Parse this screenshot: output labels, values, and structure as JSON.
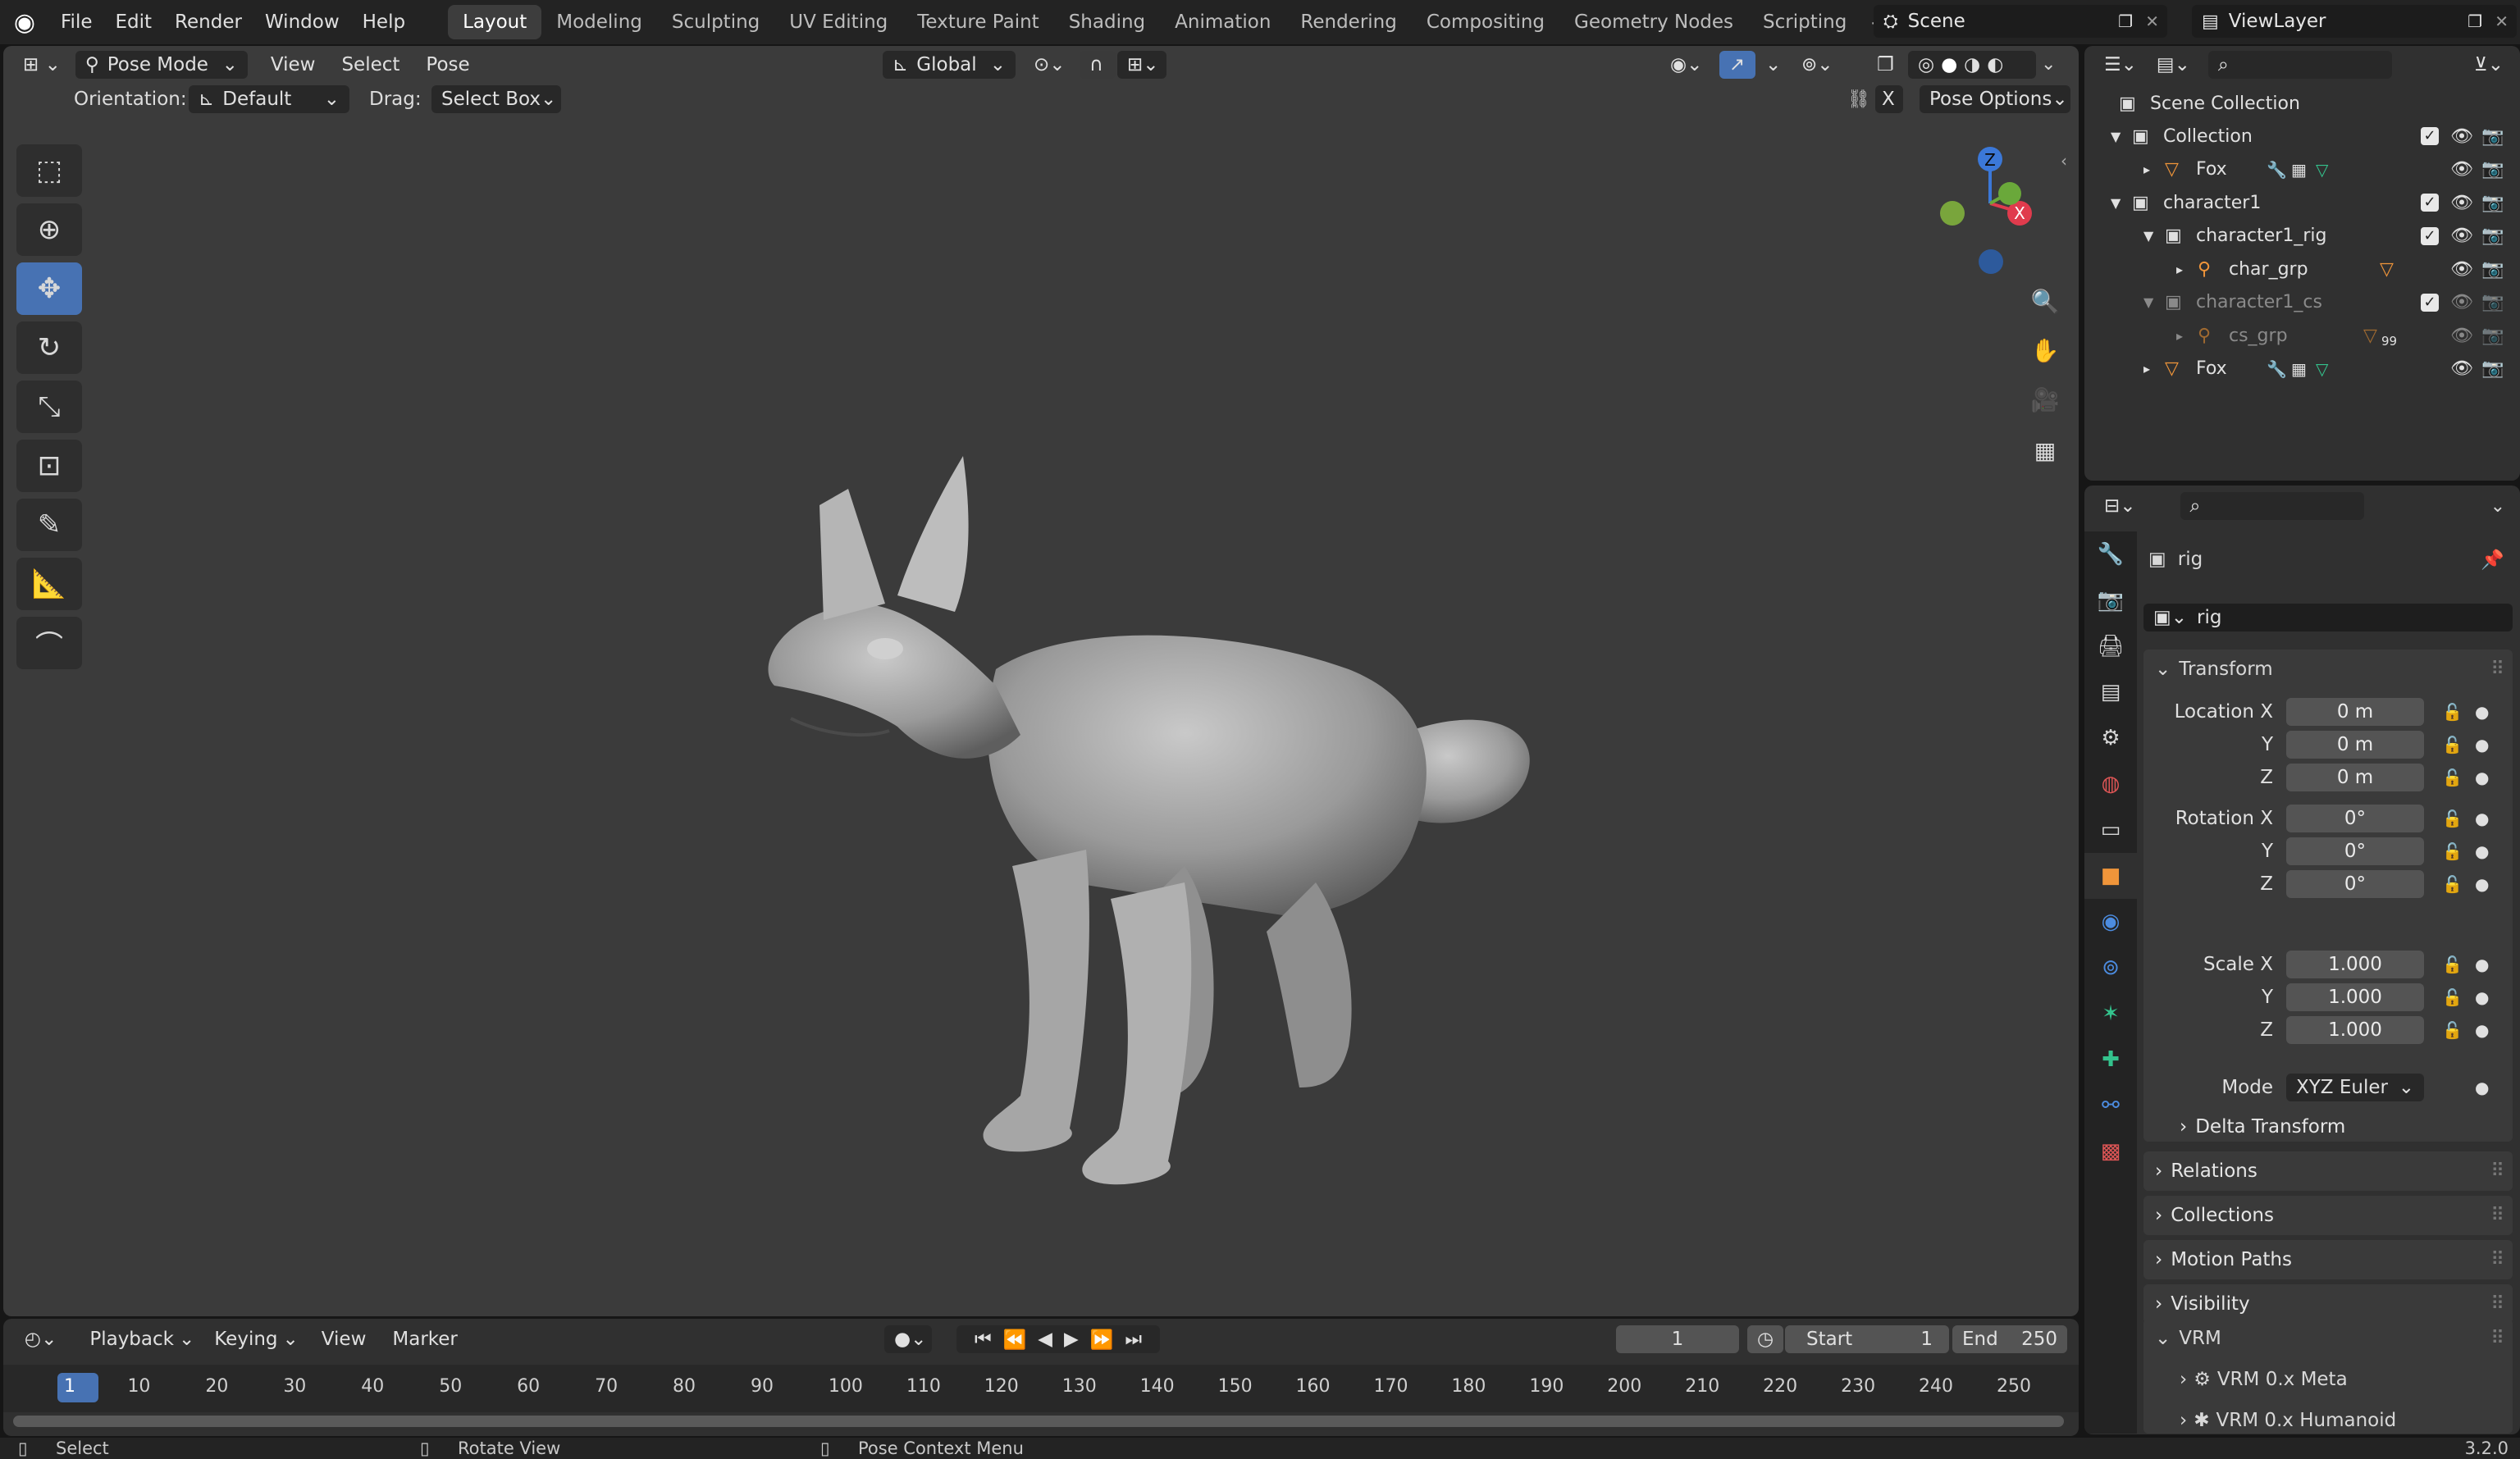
{
  "topbar": {
    "menus": [
      "File",
      "Edit",
      "Render",
      "Window",
      "Help"
    ],
    "workspaces": [
      "Layout",
      "Modeling",
      "Sculpting",
      "UV Editing",
      "Texture Paint",
      "Shading",
      "Animation",
      "Rendering",
      "Compositing",
      "Geometry Nodes",
      "Scripting"
    ],
    "scene": "Scene",
    "view_layer": "ViewLayer"
  },
  "viewport": {
    "mode": "Pose Mode",
    "menus": [
      "View",
      "Select",
      "Pose"
    ],
    "transform_orientation": "Global",
    "orientation_label": "Orientation:",
    "orientation_value": "Default",
    "drag_label": "Drag:",
    "drag_value": "Select Box",
    "x_mirror": "X",
    "pose_options": "Pose Options",
    "gizmo": {
      "z": "Z",
      "x": "X"
    }
  },
  "outliner": {
    "root": "Scene Collection",
    "rows": [
      {
        "label": "Collection"
      },
      {
        "label": "Fox"
      },
      {
        "label": "character1"
      },
      {
        "label": "character1_rig"
      },
      {
        "label": "char_grp"
      },
      {
        "label": "character1_cs"
      },
      {
        "label": "cs_grp",
        "badge": "99"
      },
      {
        "label": "Fox"
      }
    ]
  },
  "properties": {
    "object_name": "rig",
    "datablock": "rig",
    "transform": {
      "title": "Transform",
      "location_label": "Location X",
      "location": [
        "0 m",
        "0 m",
        "0 m"
      ],
      "rotation_label": "Rotation X",
      "rotation": [
        "0°",
        "0°",
        "0°"
      ],
      "mode_label": "Mode",
      "mode": "XYZ Euler",
      "scale_label": "Scale X",
      "scale": [
        "1.000",
        "1.000",
        "1.000"
      ],
      "y": "Y",
      "z": "Z",
      "delta": "Delta Transform"
    },
    "sections": [
      "Relations",
      "Collections",
      "Motion Paths",
      "Visibility"
    ],
    "vrm": {
      "title": "VRM",
      "items": [
        "VRM 0.x Meta",
        "VRM 0.x Humanoid"
      ]
    }
  },
  "timeline": {
    "menus": [
      "Playback",
      "Keying",
      "View",
      "Marker"
    ],
    "current_frame": "1",
    "start_label": "Start",
    "start": "1",
    "end_label": "End",
    "end": "250",
    "ticks": [
      "1",
      "10",
      "20",
      "30",
      "40",
      "50",
      "60",
      "70",
      "80",
      "90",
      "100",
      "110",
      "120",
      "130",
      "140",
      "150",
      "160",
      "170",
      "180",
      "190",
      "200",
      "210",
      "220",
      "230",
      "240",
      "250"
    ]
  },
  "statusbar": {
    "select": "Select",
    "rotate": "Rotate View",
    "context": "Pose Context Menu",
    "version": "3.2.0"
  }
}
